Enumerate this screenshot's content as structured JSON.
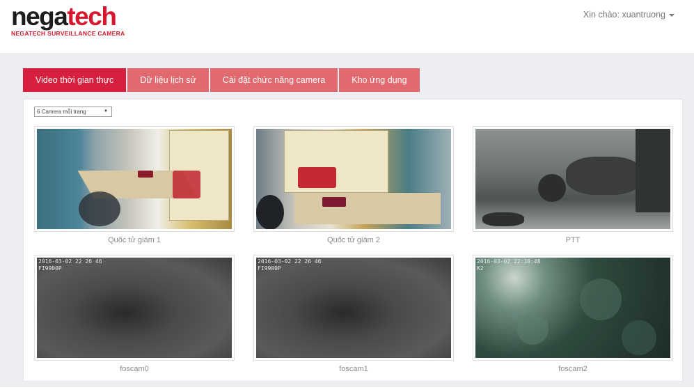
{
  "brand": {
    "part1": "nega",
    "part2": "tech",
    "tagline": "NEGATECH SURVEILLANCE CAMERA"
  },
  "user_menu": {
    "greeting": "Xin chào: xuantruong"
  },
  "tabs": [
    {
      "label": "Video thời gian thực",
      "active": true
    },
    {
      "label": "Dữ liệu lịch sử",
      "active": false
    },
    {
      "label": "Cài đặt chức năng camera",
      "active": false
    },
    {
      "label": "Kho ứng dụng",
      "active": false
    }
  ],
  "per_page": {
    "selected": "6 Camera mỗi trang"
  },
  "cameras": [
    {
      "name": "Quốc tử giám 1",
      "overlay": ""
    },
    {
      "name": "Quốc tử giám 2",
      "overlay": ""
    },
    {
      "name": "PTT",
      "overlay": ""
    },
    {
      "name": "foscam0",
      "overlay": "2016-03-02 22 26 46",
      "overlay_model": "FI9900P"
    },
    {
      "name": "foscam1",
      "overlay": "2016-03-02 22 26 46",
      "overlay_model": "FI9900P"
    },
    {
      "name": "foscam2",
      "overlay": "2016-03-02 22:38:48",
      "overlay_model": "K2"
    }
  ],
  "colors": {
    "brand_red": "#d6182e",
    "tab_active": "#d71f3f",
    "tab_inactive": "#e06a6f"
  }
}
